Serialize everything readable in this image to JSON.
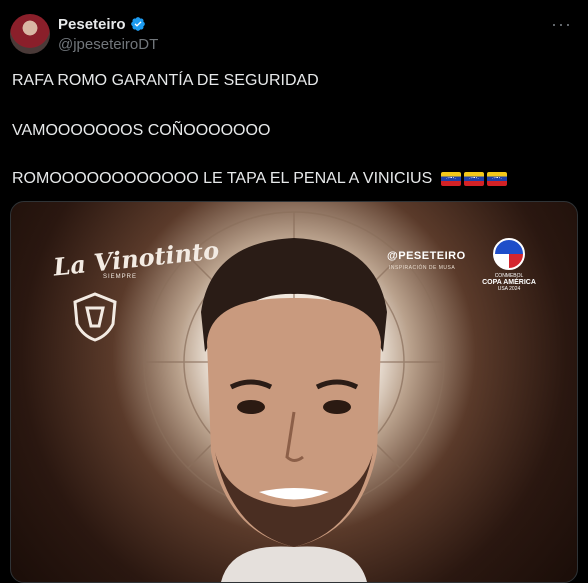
{
  "author": {
    "name": "Peseteiro",
    "handle": "@jpeseteiroDT",
    "verified": true,
    "avatar_icon": "avatar-photo"
  },
  "menu_icon": "more-horizontal-icon",
  "tweet": {
    "line1": "RAFA ROMO GARANTÍA DE SEGURIDAD",
    "line2": "VAMOOOOOOOS COÑOOOOOOO",
    "line3": "ROMOOOOOOOOOOOO LE TAPA EL PENAL A VINICIUS",
    "emoji": [
      "venezuela-flag",
      "venezuela-flag",
      "venezuela-flag"
    ]
  },
  "media": {
    "logo_left": "La Vinotinto",
    "logo_left_sub": "SIEMPRE",
    "brand": "@PESETEIRO",
    "brand_sub": "INSPIRACIÓN DE MUSA",
    "tournament_top": "CONMEBOL",
    "tournament": "COPA AMÉRICA",
    "tournament_sub": "USA 2024",
    "colors": {
      "frame": "#5a3a2a",
      "halo": "#f1e8de"
    }
  }
}
